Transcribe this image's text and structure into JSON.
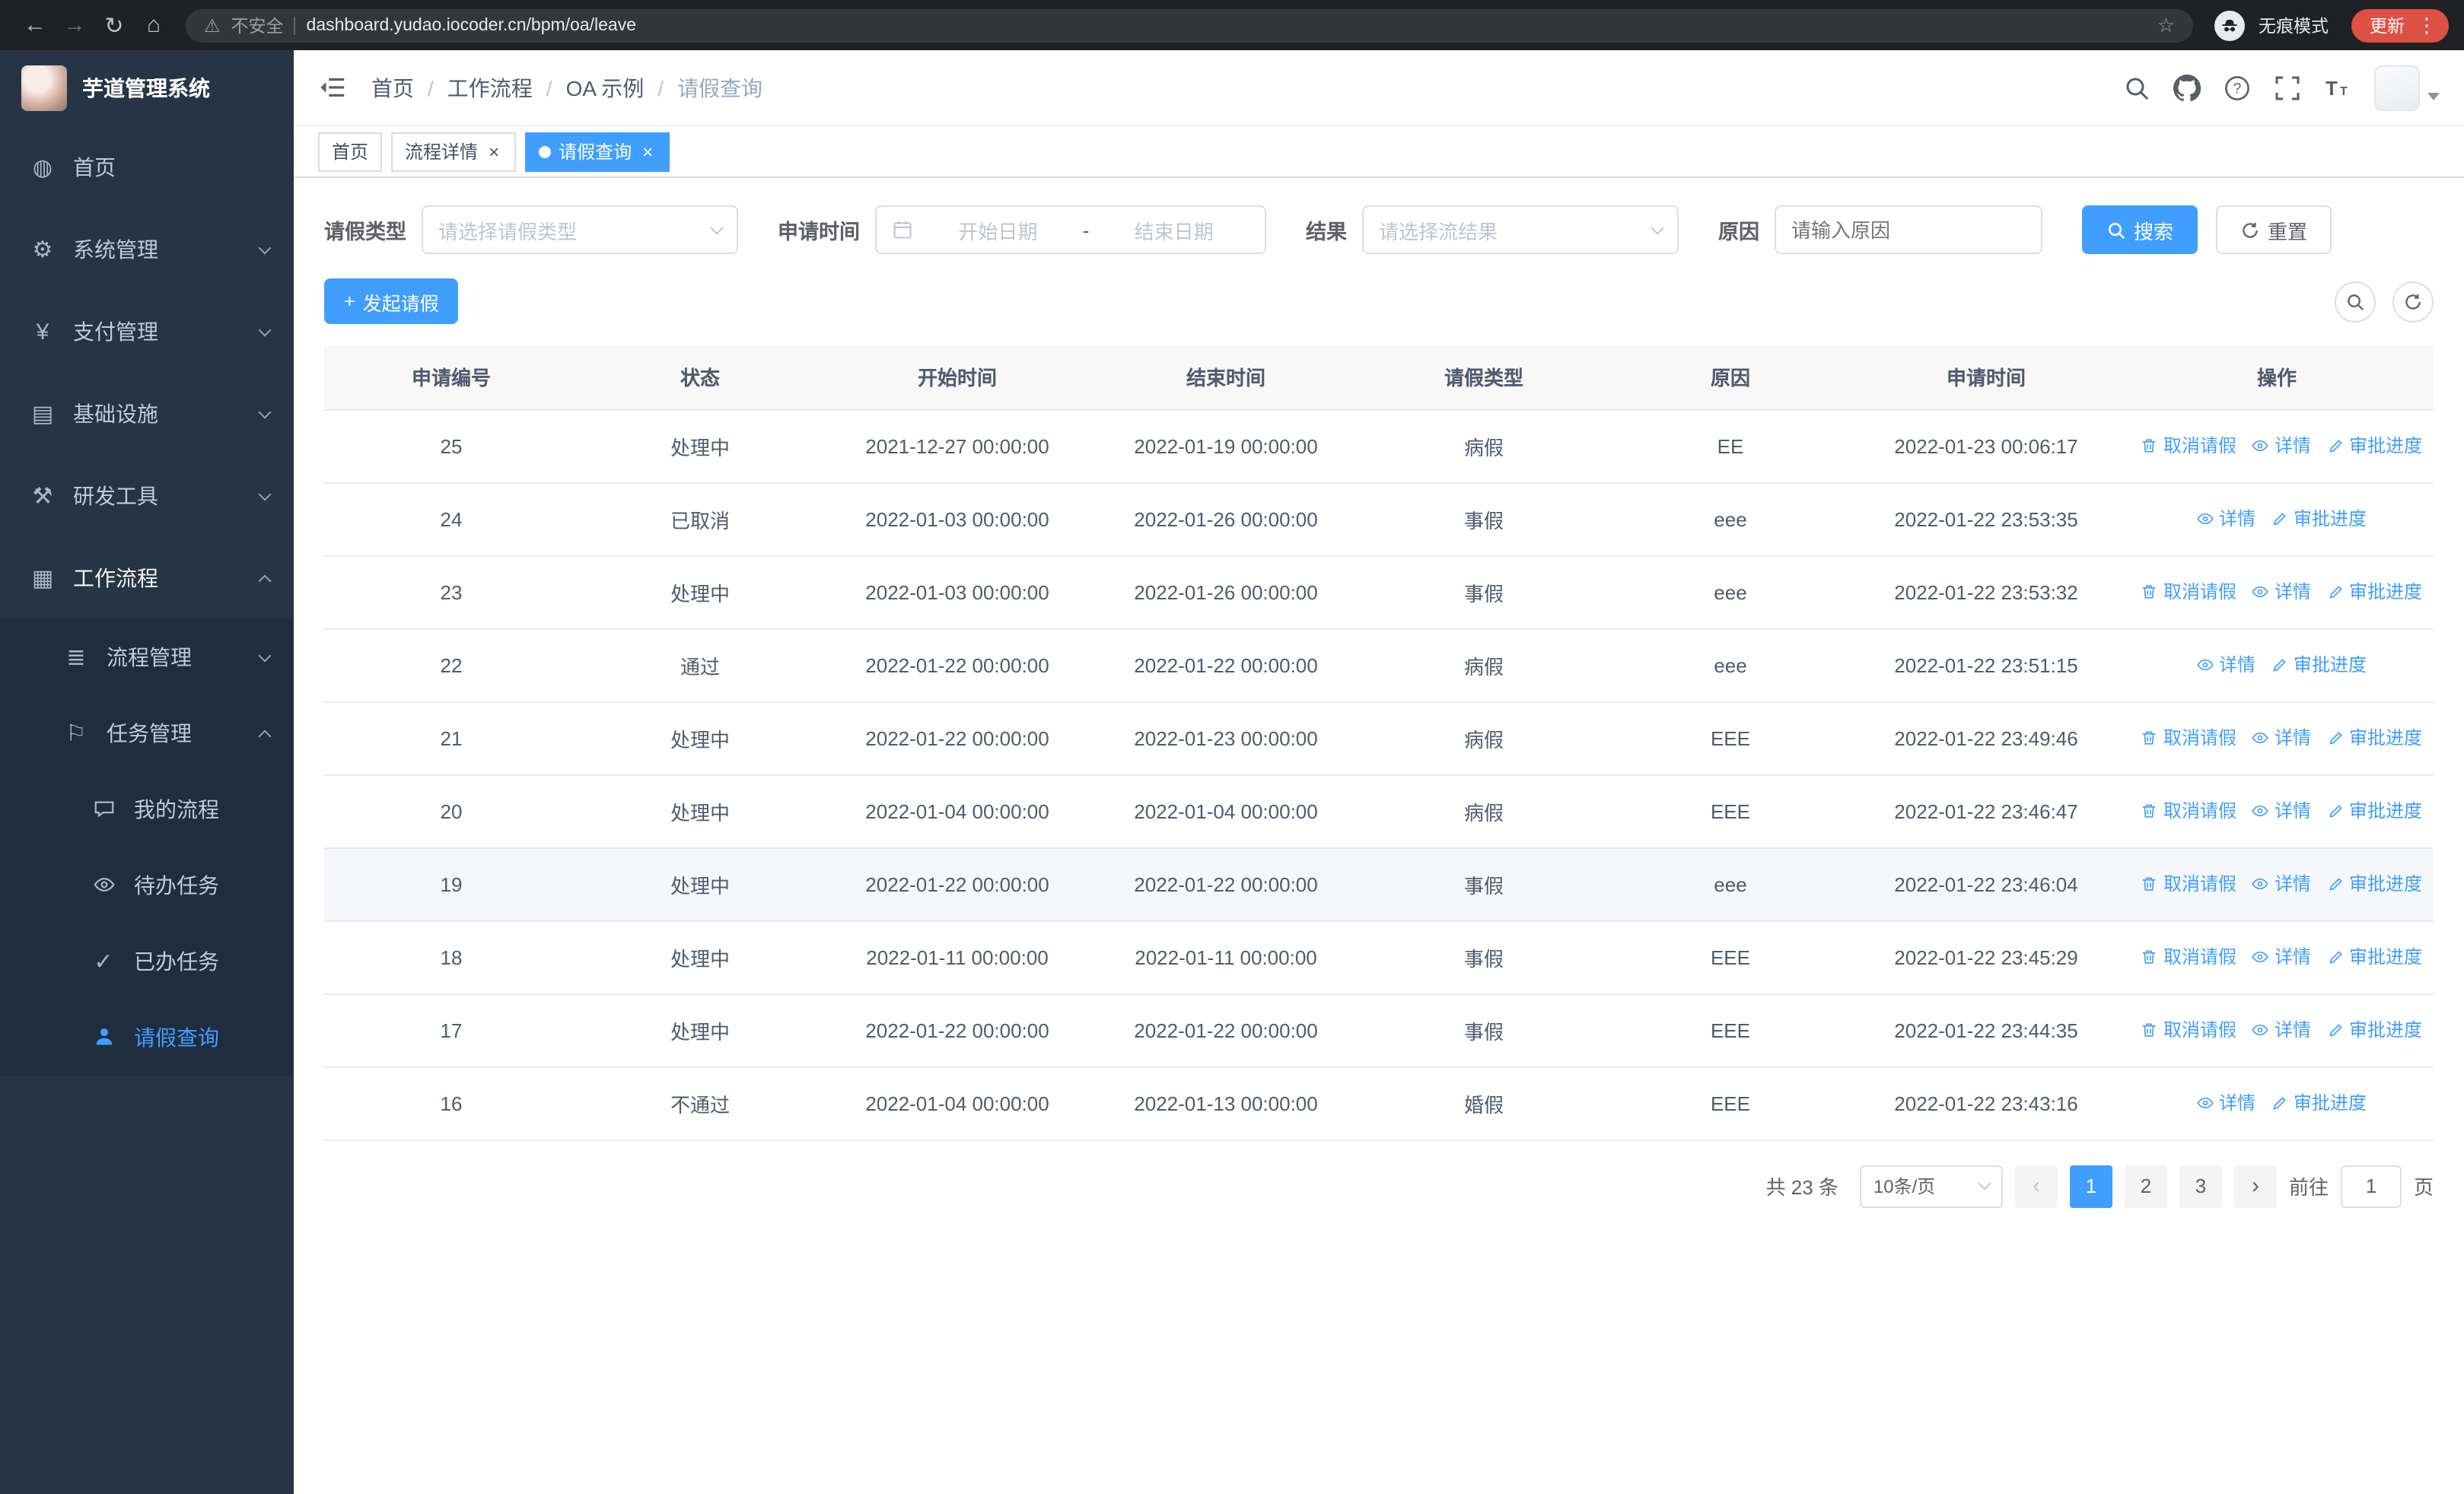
{
  "colors": {
    "accent": "#409eff",
    "sidebar_bg": "#263445",
    "sidebar_submenu_bg": "#1f2d3e",
    "chrome_bg": "#202124",
    "update_chip_bg": "#dd5144",
    "table_header_bg": "#f8f8f9"
  },
  "icons": {
    "back": "←",
    "forward": "→",
    "reload": "↻",
    "home": "⌂",
    "warning": "⚠",
    "star": "☆",
    "more": "⋮",
    "close": "×",
    "plus": "+",
    "prev": "‹",
    "next": "›",
    "menu_home": "◍",
    "menu_system": "⚙",
    "menu_pay": "¥",
    "menu_infra": "▤",
    "menu_devtools": "⚒",
    "menu_workflow": "▦",
    "menu_process": "≣",
    "menu_task": "⚐",
    "menu_done": "✓"
  },
  "browser": {
    "security_label": "不安全",
    "url": "dashboard.yudao.iocoder.cn/bpm/oa/leave",
    "incognito_label": "无痕模式",
    "update_label": "更新"
  },
  "sidebar": {
    "title": "芋道管理系统",
    "home": "首页",
    "system": "系统管理",
    "pay": "支付管理",
    "infra": "基础设施",
    "devtools": "研发工具",
    "workflow": "工作流程",
    "process_mgmt": "流程管理",
    "task_mgmt": "任务管理",
    "my_process": "我的流程",
    "todo_tasks": "待办任务",
    "done_tasks": "已办任务",
    "leave_query": "请假查询"
  },
  "header": {
    "breadcrumb": [
      "首页",
      "工作流程",
      "OA 示例",
      "请假查询"
    ]
  },
  "tabs": [
    {
      "label": "首页"
    },
    {
      "label": "流程详情"
    },
    {
      "label": "请假查询"
    }
  ],
  "filters": {
    "leave_type_label": "请假类型",
    "leave_type_placeholder": "请选择请假类型",
    "apply_time_label": "申请时间",
    "start_date_placeholder": "开始日期",
    "range_separator": "-",
    "end_date_placeholder": "结束日期",
    "result_label": "结果",
    "result_placeholder": "请选择流结果",
    "reason_label": "原因",
    "reason_placeholder": "请输入原因",
    "search_button": "搜索",
    "reset_button": "重置"
  },
  "toolbar": {
    "create_button": "发起请假"
  },
  "table": {
    "columns": [
      "申请编号",
      "状态",
      "开始时间",
      "结束时间",
      "请假类型",
      "原因",
      "申请时间",
      "操作"
    ],
    "actions": {
      "cancel": "取消请假",
      "detail": "详情",
      "progress": "审批进度"
    },
    "rows": [
      {
        "id": "25",
        "status": "处理中",
        "start": "2021-12-27 00:00:00",
        "end": "2022-01-19 00:00:00",
        "type": "病假",
        "reason": "EE",
        "applied": "2022-01-23 00:06:17",
        "can_cancel": true,
        "highlighted": false
      },
      {
        "id": "24",
        "status": "已取消",
        "start": "2022-01-03 00:00:00",
        "end": "2022-01-26 00:00:00",
        "type": "事假",
        "reason": "eee",
        "applied": "2022-01-22 23:53:35",
        "can_cancel": false,
        "highlighted": false
      },
      {
        "id": "23",
        "status": "处理中",
        "start": "2022-01-03 00:00:00",
        "end": "2022-01-26 00:00:00",
        "type": "事假",
        "reason": "eee",
        "applied": "2022-01-22 23:53:32",
        "can_cancel": true,
        "highlighted": false
      },
      {
        "id": "22",
        "status": "通过",
        "start": "2022-01-22 00:00:00",
        "end": "2022-01-22 00:00:00",
        "type": "病假",
        "reason": "eee",
        "applied": "2022-01-22 23:51:15",
        "can_cancel": false,
        "highlighted": false
      },
      {
        "id": "21",
        "status": "处理中",
        "start": "2022-01-22 00:00:00",
        "end": "2022-01-23 00:00:00",
        "type": "病假",
        "reason": "EEE",
        "applied": "2022-01-22 23:49:46",
        "can_cancel": true,
        "highlighted": false
      },
      {
        "id": "20",
        "status": "处理中",
        "start": "2022-01-04 00:00:00",
        "end": "2022-01-04 00:00:00",
        "type": "病假",
        "reason": "EEE",
        "applied": "2022-01-22 23:46:47",
        "can_cancel": true,
        "highlighted": false
      },
      {
        "id": "19",
        "status": "处理中",
        "start": "2022-01-22 00:00:00",
        "end": "2022-01-22 00:00:00",
        "type": "事假",
        "reason": "eee",
        "applied": "2022-01-22 23:46:04",
        "can_cancel": true,
        "highlighted": true
      },
      {
        "id": "18",
        "status": "处理中",
        "start": "2022-01-11 00:00:00",
        "end": "2022-01-11 00:00:00",
        "type": "事假",
        "reason": "EEE",
        "applied": "2022-01-22 23:45:29",
        "can_cancel": true,
        "highlighted": false
      },
      {
        "id": "17",
        "status": "处理中",
        "start": "2022-01-22 00:00:00",
        "end": "2022-01-22 00:00:00",
        "type": "事假",
        "reason": "EEE",
        "applied": "2022-01-22 23:44:35",
        "can_cancel": true,
        "highlighted": false
      },
      {
        "id": "16",
        "status": "不通过",
        "start": "2022-01-04 00:00:00",
        "end": "2022-01-13 00:00:00",
        "type": "婚假",
        "reason": "EEE",
        "applied": "2022-01-22 23:43:16",
        "can_cancel": false,
        "highlighted": false
      }
    ]
  },
  "pagination": {
    "total_text": "共 23 条",
    "page_size": "10条/页",
    "pages": [
      "1",
      "2",
      "3"
    ],
    "active_page": "1",
    "goto_label": "前往",
    "goto_value": "1",
    "page_suffix": "页"
  }
}
